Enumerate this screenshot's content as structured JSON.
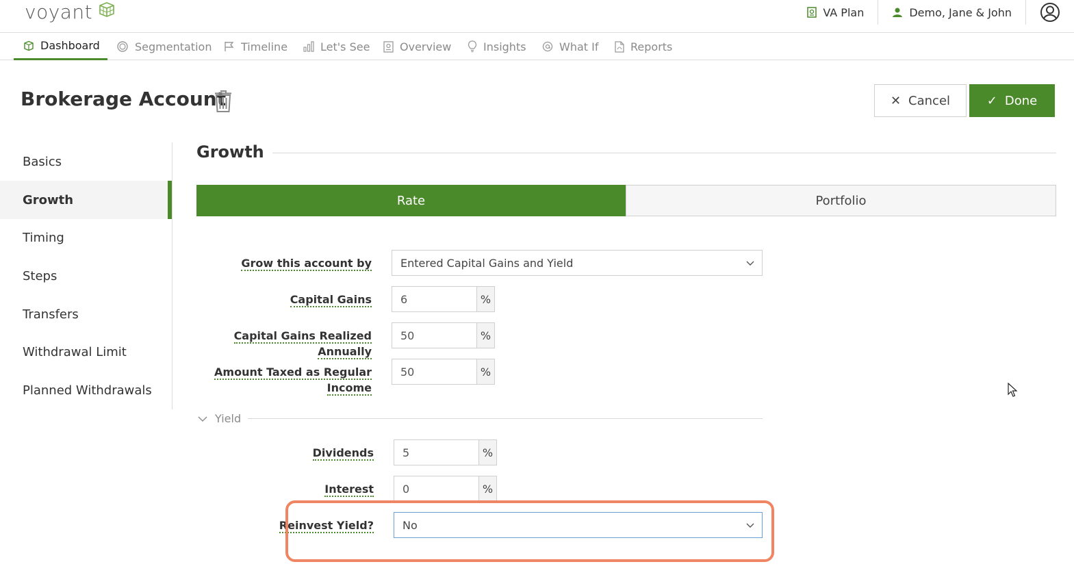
{
  "header": {
    "logo_text": "voyant",
    "plan_label": "VA Plan",
    "client_label": "Demo, Jane & John"
  },
  "nav": {
    "items": [
      {
        "label": "Dashboard",
        "icon": "dashboard-icon",
        "active": true
      },
      {
        "label": "Segmentation",
        "icon": "segmentation-icon",
        "active": false
      },
      {
        "label": "Timeline",
        "icon": "flag-icon",
        "active": false
      },
      {
        "label": "Let's See",
        "icon": "bar-chart-icon",
        "active": false
      },
      {
        "label": "Overview",
        "icon": "overview-icon",
        "active": false
      },
      {
        "label": "Insights",
        "icon": "lightbulb-icon",
        "active": false
      },
      {
        "label": "What If",
        "icon": "whatif-icon",
        "active": false
      },
      {
        "label": "Reports",
        "icon": "pdf-icon",
        "active": false
      }
    ]
  },
  "page": {
    "title": "Brokerage Account",
    "cancel_label": "Cancel",
    "done_label": "Done"
  },
  "sidebar": {
    "items": [
      {
        "label": "Basics",
        "active": false
      },
      {
        "label": "Growth",
        "active": true
      },
      {
        "label": "Timing",
        "active": false
      },
      {
        "label": "Steps",
        "active": false
      },
      {
        "label": "Transfers",
        "active": false
      },
      {
        "label": "Withdrawal Limit",
        "active": false
      },
      {
        "label": "Planned Withdrawals",
        "active": false
      }
    ]
  },
  "growth": {
    "section_title": "Growth",
    "tabs": {
      "rate": "Rate",
      "portfolio": "Portfolio",
      "selected": "Rate"
    },
    "grow_by": {
      "label": "Grow this account by",
      "value": "Entered Capital Gains and Yield"
    },
    "capital_gains": {
      "label": "Capital Gains",
      "value": "6",
      "unit": "%"
    },
    "realized_annually": {
      "label": "Capital Gains Realized Annually",
      "value": "50",
      "unit": "%"
    },
    "taxed_regular": {
      "label_line1": "Amount Taxed as Regular",
      "label_line2": "Income",
      "value": "50",
      "unit": "%"
    },
    "yield_section": "Yield",
    "dividends": {
      "label": "Dividends",
      "value": "5",
      "unit": "%"
    },
    "interest": {
      "label": "Interest",
      "value": "0",
      "unit": "%"
    },
    "reinvest": {
      "label": "Reinvest Yield?",
      "value": "No"
    }
  },
  "colors": {
    "brand_green": "#4a8a2a",
    "highlight": "#ef8563"
  }
}
